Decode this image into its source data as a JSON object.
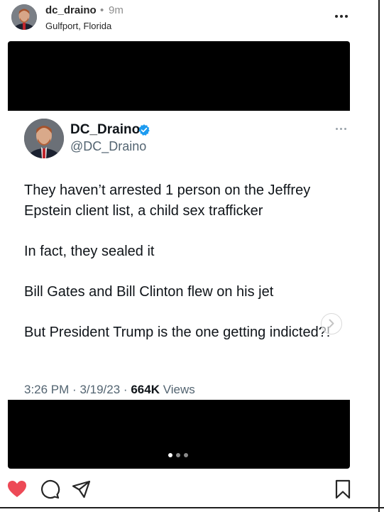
{
  "post": {
    "username": "dc_draino",
    "separator": "•",
    "time": "9m",
    "location": "Gulfport, Florida"
  },
  "tweet": {
    "display_name": "DC_Draino",
    "handle": "@DC_Draino",
    "paragraphs": [
      "They haven’t arrested 1 person on the Jeffrey Epstein client list, a child sex trafficker",
      "In fact, they sealed it",
      "Bill Gates and Bill Clinton flew on his jet",
      "But President Trump is the one getting indicted?!"
    ],
    "time": "3:26 PM",
    "date": "3/19/23",
    "views_count": "664K",
    "views_label": "Views",
    "meta_sep": "·"
  },
  "carousel": {
    "current": 1,
    "total": 3
  },
  "colors": {
    "like_active": "#ed4956",
    "verified_badge": "#1d9bf0",
    "media_background": "#000000"
  },
  "icons": [
    "more-options-icon",
    "verified-badge-icon",
    "chevron-right-icon",
    "heart-icon",
    "comment-icon",
    "share-icon",
    "bookmark-icon"
  ]
}
